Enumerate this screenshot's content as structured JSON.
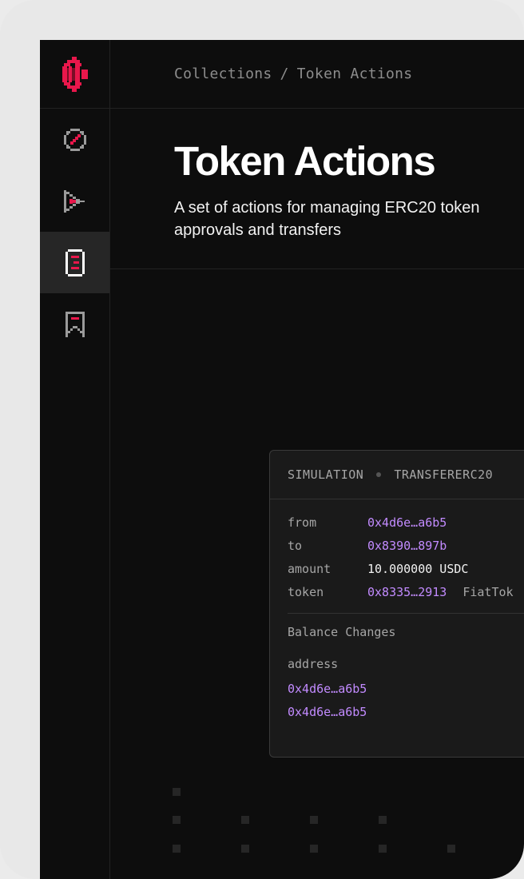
{
  "breadcrumb": {
    "root": "Collections",
    "separator": "/",
    "current": "Token Actions"
  },
  "page": {
    "title": "Token Actions",
    "description": "A set of actions for managing ERC20 token approvals and transfers"
  },
  "sidebar": {
    "items": [
      {
        "icon": "compass-icon",
        "active": false
      },
      {
        "icon": "play-icon",
        "active": false
      },
      {
        "icon": "document-icon",
        "active": true
      },
      {
        "icon": "bookmark-icon",
        "active": false
      }
    ]
  },
  "simulation": {
    "label": "SIMULATION",
    "action": "TRANSFERERC20",
    "params": [
      {
        "key": "from",
        "value": "0x4d6e…a6b5"
      },
      {
        "key": "to",
        "value": "0x8390…897b"
      },
      {
        "key": "amount",
        "value": "10.000000 USDC"
      },
      {
        "key": "token",
        "value": "0x8335…2913",
        "extra": "FiatTok"
      }
    ],
    "balance_title": "Balance Changes",
    "balance_header": "address",
    "balance_rows": [
      "0x4d6e…a6b5",
      "0x4d6e…a6b5"
    ]
  },
  "colors": {
    "background": "#0d0d0d",
    "accent": "#e8174b",
    "address": "#c28bff",
    "active_nav": "#262626"
  }
}
